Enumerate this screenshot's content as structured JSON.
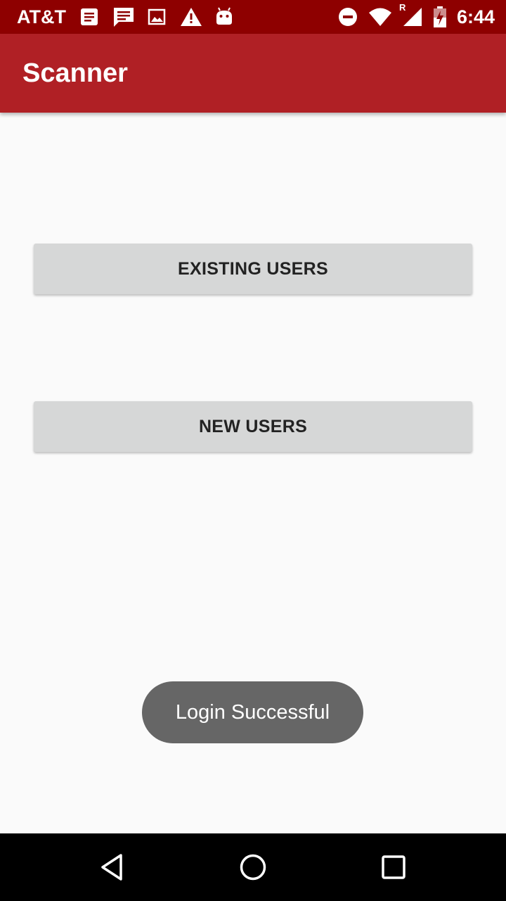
{
  "status_bar": {
    "carrier": "AT&T",
    "time": "6:44",
    "roaming_indicator": "R",
    "background_color": "#8e0000",
    "left_icons": [
      "notes-icon",
      "message-icon",
      "image-icon",
      "warning-icon",
      "android-icon"
    ],
    "right_icons": [
      "do-not-disturb-icon",
      "wifi-icon",
      "signal-icon",
      "battery-charging-icon"
    ]
  },
  "app_bar": {
    "title": "Scanner",
    "color": "#b02025"
  },
  "main": {
    "existing_users_label": "EXISTING USERS",
    "new_users_label": "NEW USERS",
    "button_color": "#d6d7d7"
  },
  "toast": {
    "message": "Login Successful",
    "color": "#666666"
  },
  "nav_bar": {
    "buttons": [
      "back-icon",
      "home-icon",
      "recents-icon"
    ]
  }
}
